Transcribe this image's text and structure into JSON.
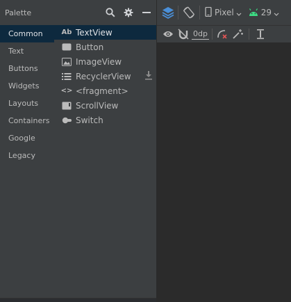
{
  "palette": {
    "title": "Palette",
    "categories": [
      {
        "label": "Common"
      },
      {
        "label": "Text"
      },
      {
        "label": "Buttons"
      },
      {
        "label": "Widgets"
      },
      {
        "label": "Layouts"
      },
      {
        "label": "Containers"
      },
      {
        "label": "Google"
      },
      {
        "label": "Legacy"
      }
    ],
    "selected_category": "Common",
    "items": [
      {
        "label": "TextView",
        "icon": "textview-icon",
        "icon_text": "Ab"
      },
      {
        "label": "Button",
        "icon": "button-icon"
      },
      {
        "label": "ImageView",
        "icon": "imageview-icon"
      },
      {
        "label": "RecyclerView",
        "icon": "recyclerview-icon",
        "downloadable": true
      },
      {
        "label": "<fragment>",
        "icon": "fragment-icon",
        "icon_text": "<>"
      },
      {
        "label": "ScrollView",
        "icon": "scrollview-icon"
      },
      {
        "label": "Switch",
        "icon": "switch-icon"
      }
    ],
    "selected_item": "TextView"
  },
  "toolbar": {
    "device": "Pixel",
    "api_level": "29",
    "margin": "0dp"
  },
  "colors": {
    "panel_bg": "#3c3f41",
    "selection_bg": "#0d293e",
    "text": "#bbbbbb",
    "layers_blue": "#4a8fd8",
    "android_green": "#3ddc84",
    "error_red": "#e05555",
    "canvas_bg": "#2b2b2b"
  }
}
